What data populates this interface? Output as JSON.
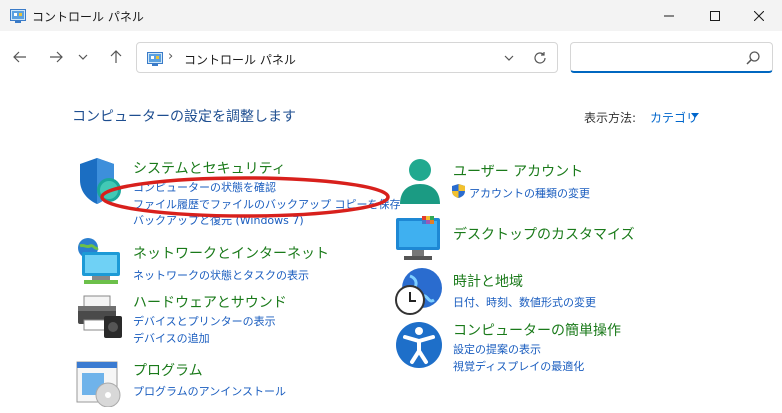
{
  "window": {
    "title": "コントロール パネル"
  },
  "nav": {
    "address_separator": "›",
    "address_text": "コントロール パネル",
    "search_placeholder": ""
  },
  "content": {
    "heading": "コンピューターの設定を調整します",
    "view_by_label": "表示方法:",
    "view_by_value": "カテゴリ"
  },
  "categories": [
    {
      "title": "システムとセキュリティ",
      "icon": "shield-icon",
      "links": [
        "コンピューターの状態を確認",
        "ファイル履歴でファイルのバックアップ コピーを保存",
        "バックアップと復元 (Windows 7)"
      ]
    },
    {
      "title": "ネットワークとインターネット",
      "icon": "network-icon",
      "links": [
        "ネットワークの状態とタスクの表示"
      ]
    },
    {
      "title": "ハードウェアとサウンド",
      "icon": "printer-icon",
      "links": [
        "デバイスとプリンターの表示",
        "デバイスの追加"
      ]
    },
    {
      "title": "プログラム",
      "icon": "programs-icon",
      "links": [
        "プログラムのアンインストール"
      ]
    },
    {
      "title": "ユーザー アカウント",
      "icon": "user-icon",
      "links": [
        "アカウントの種類の変更"
      ]
    },
    {
      "title": "デスクトップのカスタマイズ",
      "icon": "desktop-icon",
      "links": []
    },
    {
      "title": "時計と地域",
      "icon": "clock-globe-icon",
      "links": [
        "日付、時刻、数値形式の変更"
      ]
    },
    {
      "title": "コンピューターの簡単操作",
      "icon": "accessibility-icon",
      "links": [
        "設定の提案の表示",
        "視覚ディスプレイの最適化"
      ]
    }
  ],
  "colors": {
    "category_title": "#1a7a1a",
    "link": "#1a5dbf",
    "heading": "#1e4e90",
    "annotation": "#d8201c"
  }
}
